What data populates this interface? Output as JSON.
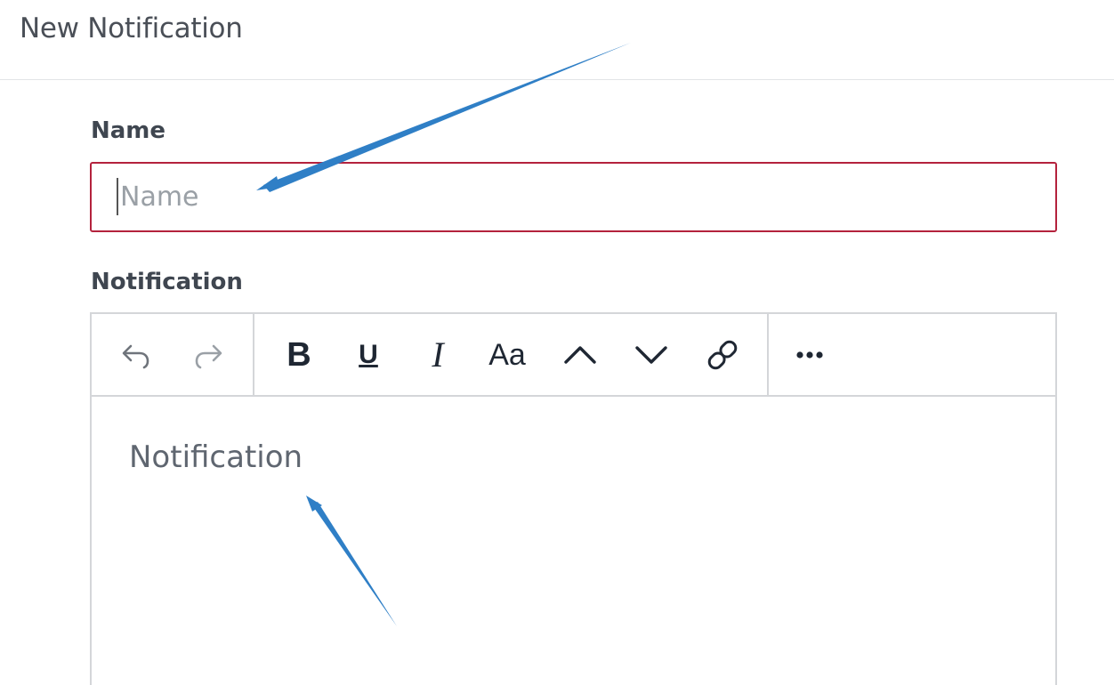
{
  "header": {
    "title": "New Notification"
  },
  "form": {
    "name_label": "Name",
    "name_placeholder": "Name",
    "name_value": "",
    "notification_label": "Notification",
    "notification_placeholder": "Notification"
  },
  "toolbar": {
    "undo_icon": "undo-icon",
    "redo_icon": "redo-icon",
    "bold_label": "B",
    "underline_label": "U",
    "italic_label": "I",
    "font_size_label": "Aa",
    "up_icon": "chevron-up-icon",
    "down_icon": "chevron-down-icon",
    "link_icon": "link-icon",
    "more_icon": "more-horizontal-icon"
  },
  "colors": {
    "input_error_border": "#b4223d",
    "annotation_arrow": "#2f7fc6",
    "toolbar_border": "#d4d6d9",
    "label_text": "#3f4650"
  }
}
